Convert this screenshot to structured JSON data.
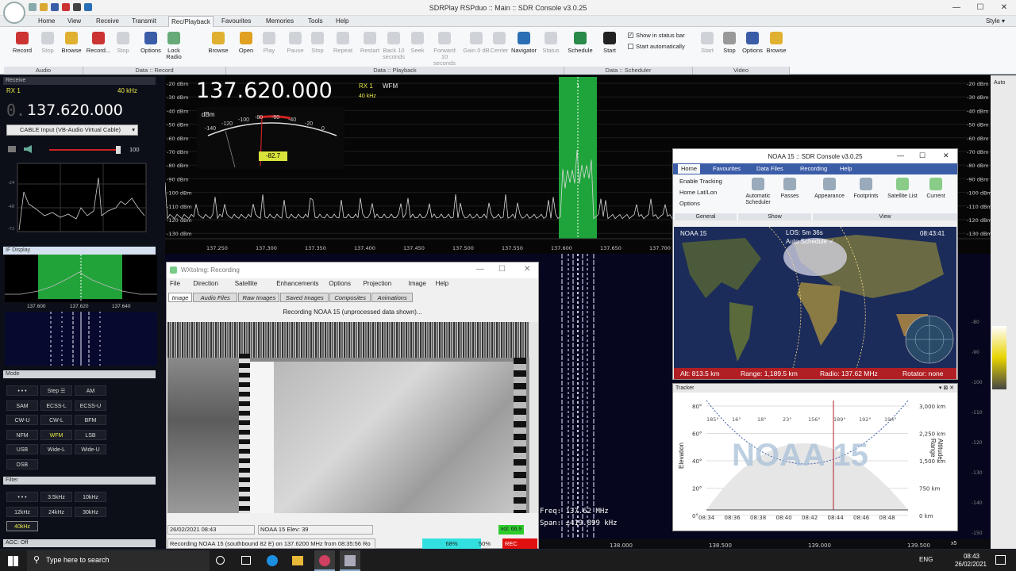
{
  "window": {
    "title": "SDRPlay RSPduo :: Main :: SDR Console v3.0.25",
    "style_label": "Style"
  },
  "menu_tabs": [
    "Home",
    "View",
    "Receive",
    "Transmit",
    "Rec/Playback",
    "Favourites",
    "Memories",
    "Tools",
    "Help"
  ],
  "ribbon": {
    "buttons": [
      {
        "label": "Record",
        "x": 10
      },
      {
        "label": "Stop",
        "x": 42,
        "dis": true
      },
      {
        "label": "Browse",
        "x": 72
      },
      {
        "label": "Record...",
        "x": 106
      },
      {
        "label": "Stop",
        "x": 137,
        "dis": true
      },
      {
        "label": "Options",
        "x": 172
      },
      {
        "label": "Lock Radio",
        "x": 201
      },
      {
        "label": "Browse",
        "x": 257
      },
      {
        "label": "Open",
        "x": 292
      },
      {
        "label": "Play",
        "x": 321,
        "dis": true
      },
      {
        "label": "Pause",
        "x": 354,
        "dis": true
      },
      {
        "label": "Stop",
        "x": 382,
        "dis": true
      },
      {
        "label": "Repeat",
        "x": 414,
        "dis": true
      },
      {
        "label": "Restart",
        "x": 448,
        "dis": true
      },
      {
        "label": "Back 10 seconds",
        "x": 478,
        "dis": true
      },
      {
        "label": "Seek",
        "x": 508,
        "dis": true
      },
      {
        "label": "Forward 10 seconds",
        "x": 542,
        "dis": true
      },
      {
        "label": "Gain 0 dB",
        "x": 582,
        "dis": true
      },
      {
        "label": "Center",
        "x": 611,
        "dis": true
      },
      {
        "label": "Navigator",
        "x": 642
      },
      {
        "label": "Status",
        "x": 676,
        "dis": true
      },
      {
        "label": "Schedule",
        "x": 713
      },
      {
        "label": "Start",
        "x": 750
      },
      {
        "label": "Start",
        "x": 873,
        "dis": true
      },
      {
        "label": "Stop",
        "x": 901
      },
      {
        "label": "Options",
        "x": 930
      },
      {
        "label": "Browse",
        "x": 960
      }
    ],
    "checks": [
      {
        "label": "Show in status bar",
        "checked": true
      },
      {
        "label": "Start automatically",
        "checked": false
      }
    ],
    "groups": [
      {
        "label": "Audio",
        "x": 5,
        "w": 100
      },
      {
        "label": "Data :: Record",
        "x": 105,
        "w": 180
      },
      {
        "label": "Data :: Playback",
        "x": 285,
        "w": 426
      },
      {
        "label": "Data :: Scheduler",
        "x": 711,
        "w": 162
      },
      {
        "label": "Video",
        "x": 873,
        "w": 122
      }
    ]
  },
  "receive": {
    "header": "Receive",
    "rx": "RX 1",
    "bw": "40 kHz",
    "freq_prefix": "0.",
    "freq": "137.620.000",
    "input": "CABLE Input (VB-Audio Virtual Cable)",
    "volume": "100"
  },
  "if_display": {
    "header": "IF Display",
    "ticks": [
      "137.600",
      "137.620",
      "137.640"
    ]
  },
  "mode": {
    "header": "Mode",
    "buttons": [
      "• • •",
      "Step ☰",
      "AM",
      "SAM",
      "ECSS-L",
      "ECSS-U",
      "CW-U",
      "CW-L",
      "BFM",
      "NFM",
      "WFM",
      "LSB",
      "USB",
      "Wide-L",
      "Wide-U",
      "DSB"
    ]
  },
  "filter": {
    "header": "Filter",
    "buttons": [
      "• • •",
      "3.5kHz",
      "10kHz",
      "12kHz",
      "24kHz",
      "30kHz",
      "40kHz"
    ]
  },
  "agc": "AGC: Off",
  "spectrum": {
    "big_freq": "137.620.000",
    "rx": "RX 1",
    "mode": "WFM",
    "bw": "40 kHz",
    "meter_unit": "dBm",
    "meter_value": "-82.7",
    "meter_ticks": [
      "-140",
      "-120",
      "-100",
      "-80",
      "-60",
      "-40",
      "-20",
      "0"
    ],
    "dbm_left": [
      "-20 dBm",
      "-30 dBm",
      "-40 dBm",
      "-50 dBm",
      "-60 dBm",
      "-70 dBm",
      "-80 dBm",
      "-90 dBm",
      "-100 dBm",
      "-110 dBm",
      "-120 dBm",
      "-130 dBm"
    ],
    "dbm_right": [
      "-20 dBm",
      "-30 dBm",
      "-40 dBm",
      "-50 dBm",
      "-60 dBm",
      "-70 dBm",
      "-80 dBm",
      "-90 dBm",
      "-100 dBm",
      "-110 dBm",
      "-120 dBm",
      "-130 dBm"
    ],
    "freq_ticks": [
      "137.250",
      "137.300",
      "137.350",
      "137.400",
      "137.450",
      "137.500",
      "137.550",
      "137.600",
      "137.650",
      "137.700"
    ],
    "marker": "1",
    "auto": "Auto"
  },
  "waterfall": {
    "ticks": [
      "138.000",
      "138.500",
      "139.000",
      "139.500"
    ],
    "right_ticks": [
      "-80",
      "-90",
      "-100",
      "-110",
      "-120",
      "-130",
      "-140",
      "-150"
    ],
    "info_freq": "Freq:   137.62 MHz",
    "info_span": "Span: ±419.899 kHz",
    "zoom": "x5"
  },
  "noaa": {
    "title": "NOAA 15 :: SDR Console v3.0.25",
    "tabs": [
      "Home",
      "Favourites",
      "Data Files",
      "Recording",
      "Help"
    ],
    "general": [
      "Enable Tracking",
      "Home Lat/Lon",
      "Options"
    ],
    "buttons": [
      "Automatic Scheduler",
      "Passes",
      "Appearance",
      "Footprints",
      "Satellite List",
      "Current"
    ],
    "groups": [
      "General",
      "Show",
      "View"
    ],
    "map_sat": "NOAA 15",
    "map_los": "LOS: 5m 36s",
    "map_auto": "Auto Schedule ✓",
    "map_time": "08:43:41",
    "status": {
      "alt": "Alt: 813.5 km",
      "range": "Range: 1,189.5 km",
      "radio": "Radio: 137.62 MHz",
      "rotator": "Rotator: none"
    }
  },
  "tracker": {
    "title": "Tracker",
    "watermark": "NOAA 15",
    "ylabel": "Elevation",
    "y2label": "Altitude, Range",
    "y_ticks": [
      "80°",
      "60°",
      "40°",
      "20°",
      "0°"
    ],
    "y2_ticks": [
      "3,000 km",
      "2,250 km",
      "1,500 km",
      "750 km",
      "0 km"
    ],
    "x_ticks": [
      "08:34",
      "08:36",
      "08:38",
      "08:40",
      "08:42",
      "08:44",
      "08:46",
      "08:48"
    ],
    "azimuths": [
      "185°",
      "16°",
      "18°",
      "23°",
      "156°",
      "189°",
      "192°",
      "194°"
    ]
  },
  "wx": {
    "title": "WXtoImg: Recording",
    "menu": [
      "File",
      "Direction",
      "Satellite",
      "Enhancements",
      "Options",
      "Projection",
      "Image",
      "Help"
    ],
    "tabs": [
      "Image",
      "Audio Files",
      "Raw Images",
      "Saved Images",
      "Composites",
      "Animations"
    ],
    "header": "Recording NOAA 15 (unprocessed data shown)...",
    "status_date": "26/02/2021  08:43",
    "status_sat": "NOAA 15   Elev: 39",
    "status_vol": "vol: 66.9",
    "status_rec": "Recording NOAA 15 (southbound 82 E) on 137.6200 MHz from 08:35:56 Ro",
    "status_pct1": "68%",
    "status_pct2": "50%",
    "status_flag": "REC"
  },
  "taskbar": {
    "search": "Type here to search",
    "time": "08:43",
    "date": "26/02/2021",
    "lang": "ENG"
  }
}
